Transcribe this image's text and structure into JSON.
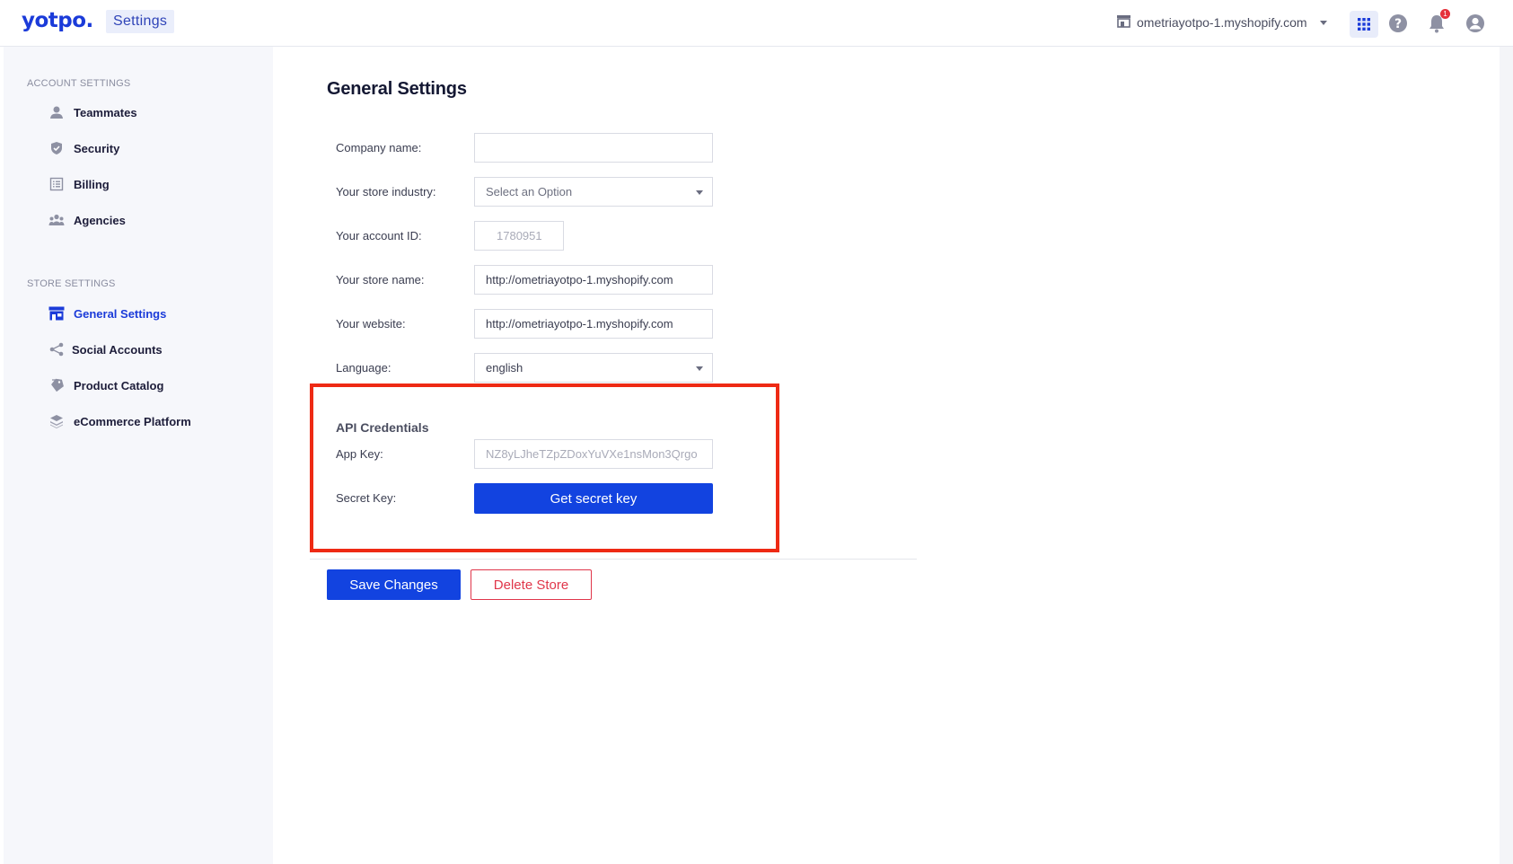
{
  "header": {
    "logo": "yotpo.",
    "section_chip": "Settings",
    "store_name": "ometriayotpo-1.myshopify.com",
    "notification_count": "1",
    "icons": [
      "store-icon",
      "apps-grid-icon",
      "help-icon",
      "bell-icon",
      "user-icon"
    ]
  },
  "sidebar": {
    "account_heading": "ACCOUNT SETTINGS",
    "account_items": [
      {
        "label": "Teammates",
        "icon": "person-icon"
      },
      {
        "label": "Security",
        "icon": "shield-icon"
      },
      {
        "label": "Billing",
        "icon": "billing-list-icon"
      },
      {
        "label": "Agencies",
        "icon": "group-icon"
      }
    ],
    "store_heading": "STORE SETTINGS",
    "store_items": [
      {
        "label": "General Settings",
        "icon": "store-icon",
        "active": true
      },
      {
        "label": "Social Accounts",
        "icon": "share-icon"
      },
      {
        "label": "Product Catalog",
        "icon": "tag-icon"
      },
      {
        "label": "eCommerce Platform",
        "icon": "layers-icon"
      }
    ]
  },
  "main": {
    "title": "General Settings",
    "company_name": {
      "label": "Company name:",
      "value": ""
    },
    "industry": {
      "label": "Your store industry:",
      "value": "Select an Option"
    },
    "account_id": {
      "label": "Your account ID:",
      "value": "1780951"
    },
    "store_name": {
      "label": "Your store name:",
      "value": "http://ometriayotpo-1.myshopify.com"
    },
    "website": {
      "label": "Your website:",
      "value": "http://ometriayotpo-1.myshopify.com"
    },
    "language": {
      "label": "Language:",
      "value": "english"
    },
    "api": {
      "title": "API Credentials",
      "app_key_label": "App Key:",
      "app_key_value": "NZ8yLJheTZpZDoxYuVXe1nsMon3Qrgo",
      "secret_key_label": "Secret Key:",
      "secret_button": "Get secret key"
    },
    "save_button": "Save Changes",
    "delete_button": "Delete Store"
  },
  "colors": {
    "brand": "#1b3bd9",
    "primary_button": "#1243e0",
    "danger": "#e0364a",
    "highlight_box": "#ee2a14"
  }
}
